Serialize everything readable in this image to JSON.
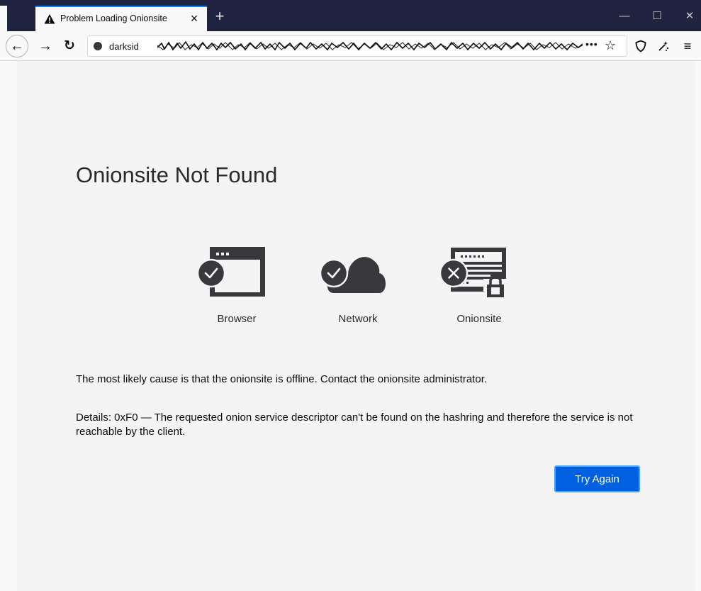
{
  "tab": {
    "title": "Problem Loading Onionsite",
    "close_glyph": "×",
    "warning_icon": "warning-icon"
  },
  "newtab_glyph": "+",
  "window_controls": {
    "minimize": "—",
    "maximize": "☐",
    "close": "✕"
  },
  "nav": {
    "back_glyph": "←",
    "forward_glyph": "→",
    "reload_glyph": "↻",
    "url_visible": "darksid",
    "more_glyph": "•••",
    "star_glyph": "☆",
    "menu_glyph": "≡"
  },
  "page": {
    "title": "Onionsite Not Found",
    "diagnostics": [
      {
        "label": "Browser",
        "status": "ok"
      },
      {
        "label": "Network",
        "status": "ok"
      },
      {
        "label": "Onionsite",
        "status": "error"
      }
    ],
    "message": "The most likely cause is that the onionsite is offline. Contact the onionsite administrator.",
    "details": "Details: 0xF0 — The requested onion service descriptor can't be found on the hashring and therefore the service is not reachable by the client.",
    "try_again": "Try Again"
  },
  "colors": {
    "titlebar": "#202340",
    "accent": "#0060df",
    "icon_dark": "#38383d"
  }
}
